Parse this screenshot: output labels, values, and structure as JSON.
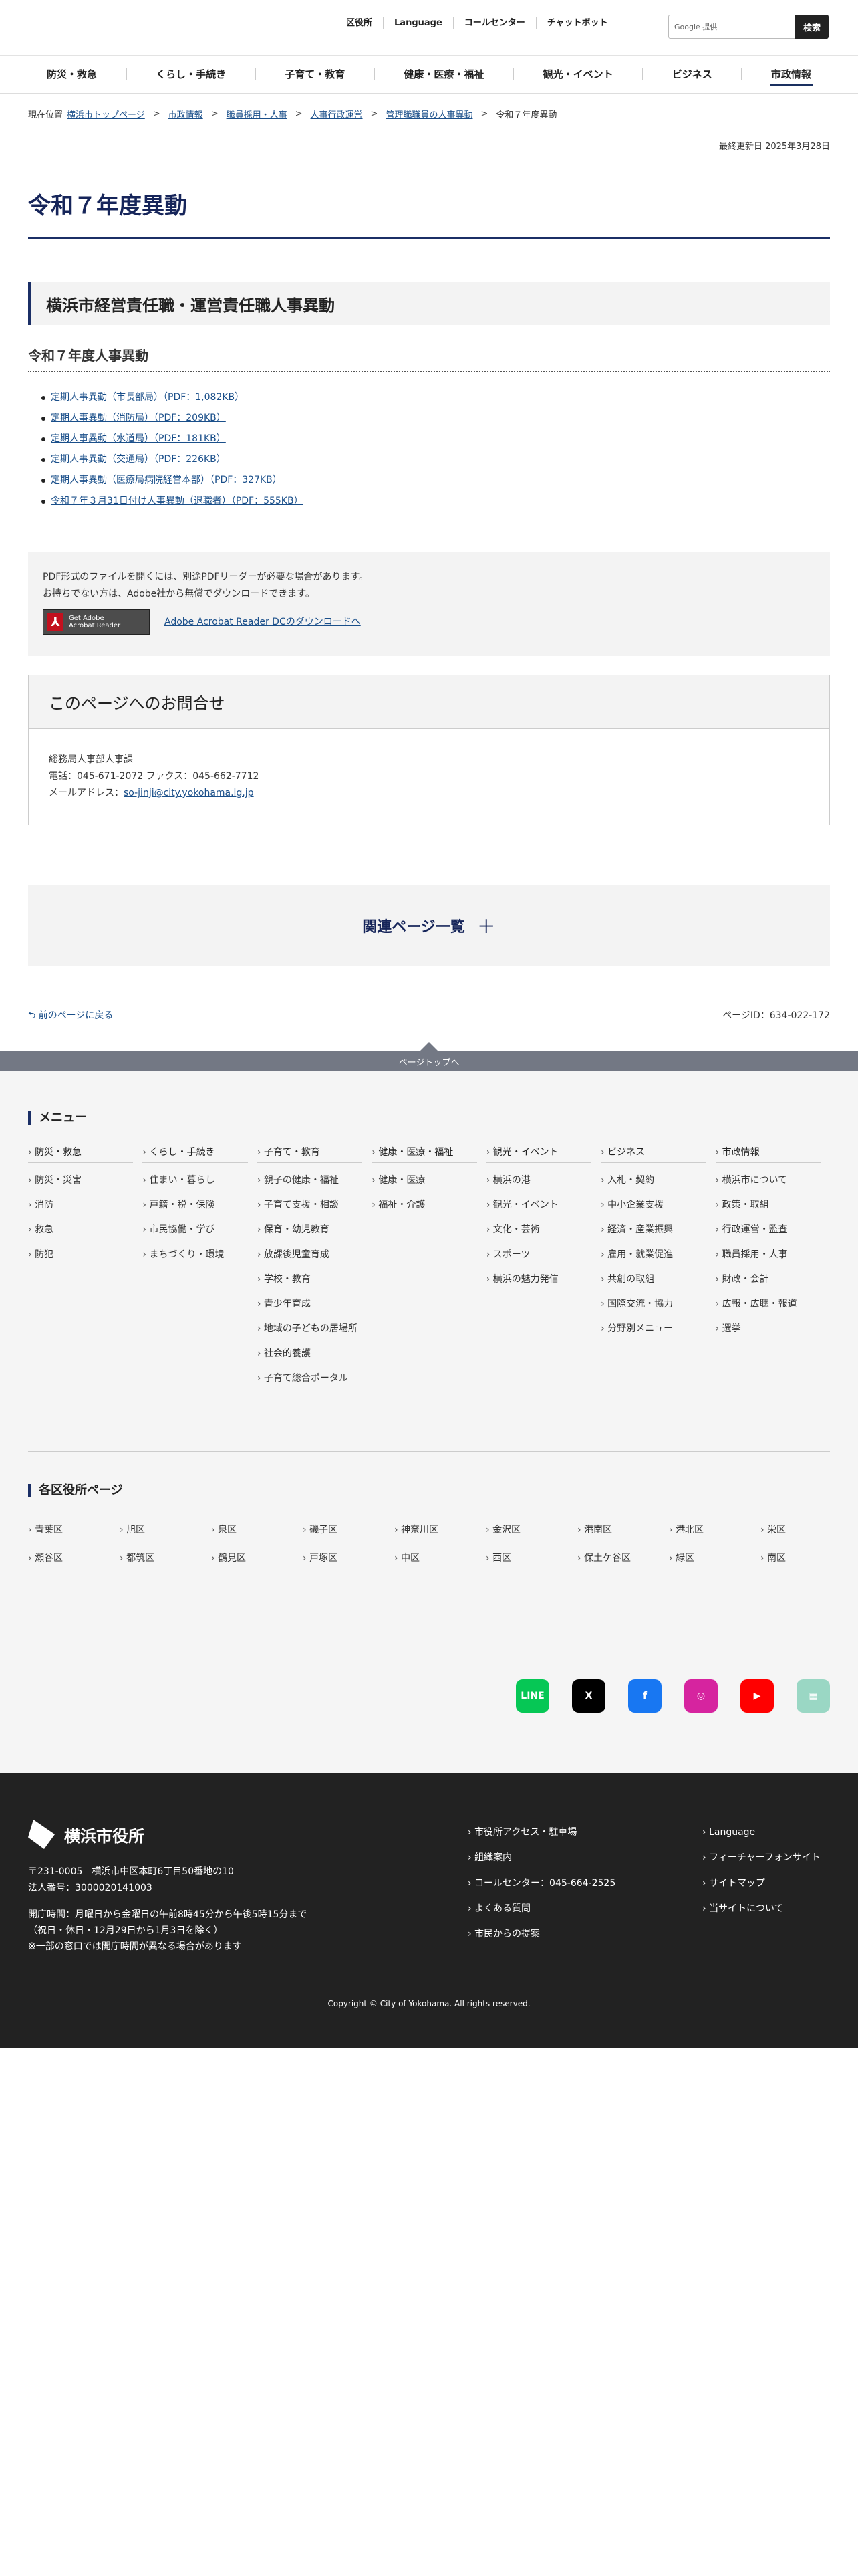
{
  "header": {
    "util": [
      "区役所",
      "Language",
      "コールセンター",
      "チャットボット"
    ],
    "search_placeholder": "Google 提供",
    "search_button": "検索",
    "gnav": [
      "防災・救急",
      "くらし・手続き",
      "子育て・教育",
      "健康・医療・福祉",
      "観光・イベント",
      "ビジネス",
      "市政情報"
    ]
  },
  "breadcrumb": {
    "current_label": "現在位置",
    "items": [
      "横浜市トップページ",
      "市政情報",
      "職員採用・人事",
      "人事行政運営",
      "管理職職員の人事異動"
    ],
    "current": "令和７年度異動"
  },
  "updated": "最終更新日 2025年3月28日",
  "title": "令和７年度異動",
  "section": {
    "h2": "横浜市経営責任職・運営責任職人事異動",
    "h3": "令和７年度人事異動",
    "links": [
      "定期人事異動（市長部局）（PDF：1,082KB）",
      "定期人事異動（消防局）（PDF：209KB）",
      "定期人事異動（水道局）（PDF：181KB）",
      "定期人事異動（交通局）（PDF：226KB）",
      "定期人事異動（医療局病院経営本部）（PDF：327KB）",
      "令和７年３月31日付け人事異動（退職者）（PDF：555KB）"
    ]
  },
  "pdf": {
    "line1": "PDF形式のファイルを開くには、別途PDFリーダーが必要な場合があります。",
    "line2": "お持ちでない方は、Adobe社から無償でダウンロードできます。",
    "badge_line1": "Get Adobe",
    "badge_line2": "Acrobat Reader",
    "link": "Adobe Acrobat Reader DCのダウンロードへ"
  },
  "contact": {
    "title": "このページへのお問合せ",
    "dept": "総務局人事部人事課",
    "phone": "電話：045-671-2072",
    "fax": "ファクス：045-662-7712",
    "mail_label": "メールアドレス：",
    "mail": "so-jinji@city.yokohama.lg.jp"
  },
  "related": "関連ページ一覧",
  "back": "前のページに戻る",
  "page_id": "ページID：634-022-172",
  "pagetop": "ページトップへ",
  "menu": {
    "title": "メニュー",
    "cols": [
      {
        "cat": "防災・救急",
        "items": [
          "防災・災害",
          "消防",
          "救急",
          "防犯"
        ]
      },
      {
        "cat": "くらし・手続き",
        "items": [
          "住まい・暮らし",
          "戸籍・税・保険",
          "市民協働・学び",
          "まちづくり・環境"
        ]
      },
      {
        "cat": "子育て・教育",
        "items": [
          "親子の健康・福祉",
          "子育て支援・相談",
          "保育・幼児教育",
          "放課後児童育成",
          "学校・教育",
          "青少年育成",
          "地域の子どもの居場所",
          "社会的養護",
          "子育て総合ポータル"
        ]
      },
      {
        "cat": "健康・医療・福祉",
        "items": [
          "健康・医療",
          "福祉・介護"
        ]
      },
      {
        "cat": "観光・イベント",
        "items": [
          "横浜の港",
          "観光・イベント",
          "文化・芸術",
          "スポーツ",
          "横浜の魅力発信"
        ]
      },
      {
        "cat": "ビジネス",
        "items": [
          "入札・契約",
          "中小企業支援",
          "経済・産業振興",
          "雇用・就業促進",
          "共創の取組",
          "国際交流・協力",
          "分野別メニュー"
        ]
      },
      {
        "cat": "市政情報",
        "items": [
          "横浜市について",
          "政策・取組",
          "行政運営・監査",
          "職員採用・人事",
          "財政・会計",
          "広報・広聴・報道",
          "選挙"
        ]
      }
    ]
  },
  "wards": {
    "title": "各区役所ページ",
    "items": [
      "青葉区",
      "旭区",
      "泉区",
      "磯子区",
      "神奈川区",
      "金沢区",
      "港南区",
      "港北区",
      "栄区",
      "瀬谷区",
      "都筑区",
      "鶴見区",
      "戸塚区",
      "中区",
      "西区",
      "保土ケ谷区",
      "緑区",
      "南区"
    ]
  },
  "social": [
    {
      "icon": "line-icon",
      "label": "LINE",
      "color": "#06c755"
    },
    {
      "icon": "x-icon",
      "label": "X",
      "color": "#000000"
    },
    {
      "icon": "facebook-icon",
      "label": "f",
      "color": "#1877f2"
    },
    {
      "icon": "instagram-icon",
      "label": "◎",
      "color": "#d6249f"
    },
    {
      "icon": "youtube-icon",
      "label": "▶",
      "color": "#ff0000"
    },
    {
      "icon": "calendar-icon",
      "label": "▦",
      "color": "#9ad7c4"
    }
  ],
  "footer": {
    "name": "横浜市役所",
    "postal": "〒231-0005　横浜市中区本町6丁目50番地の10",
    "corp": "法人番号：3000020141003",
    "hours1": "開庁時間：月曜日から金曜日の午前8時45分から午後5時15分まで",
    "hours2": "（祝日・休日・12月29日から1月3日を除く）",
    "hours3": "※一部の窓口では開庁時間が異なる場合があります",
    "links_left": [
      "市役所アクセス・駐車場",
      "組織案内",
      "コールセンター：045-664-2525",
      "よくある質問",
      "市民からの提案"
    ],
    "links_right": [
      "Language",
      "フィーチャーフォンサイト",
      "サイトマップ",
      "当サイトについて"
    ],
    "copyright": "Copyright © City of Yokohama. All rights reserved."
  }
}
